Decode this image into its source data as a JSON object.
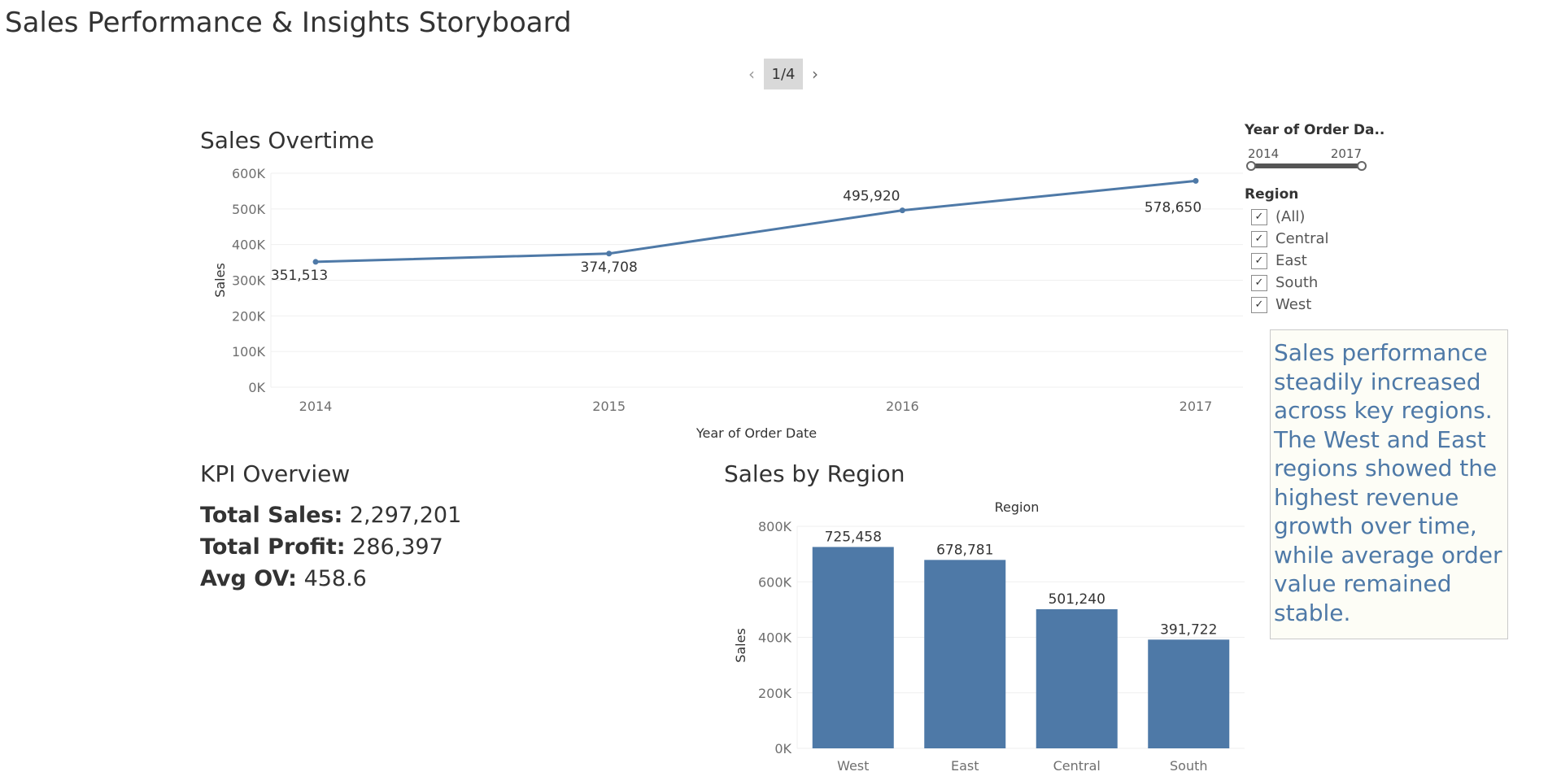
{
  "page": {
    "title": "Sales Performance & Insights Storyboard",
    "pager": {
      "current": "1/4",
      "prev_icon": "chevron-left-icon",
      "next_icon": "chevron-right-icon"
    }
  },
  "colors": {
    "series": "#4e79a7",
    "caption_text": "#4e79a7"
  },
  "line_chart": {
    "title": "Sales Overtime"
  },
  "kpi": {
    "title": "KPI Overview",
    "items": [
      {
        "label": "Total Sales:",
        "value": "2,297,201"
      },
      {
        "label": "Total Profit:",
        "value": "286,397"
      },
      {
        "label": "Avg OV:",
        "value": "458.6"
      }
    ]
  },
  "bar_chart": {
    "title": "Sales by Region"
  },
  "filters": {
    "year": {
      "title": "Year of Order Da..",
      "min_label": "2014",
      "max_label": "2017"
    },
    "region": {
      "title": "Region",
      "options": [
        "(All)",
        "Central",
        "East",
        "South",
        "West"
      ],
      "check_glyph": "✓"
    }
  },
  "caption": "Sales performance steadily increased across key regions. The West and East regions showed the highest revenue growth over time, while average order value remained stable.",
  "chart_data": [
    {
      "type": "line",
      "title": "Sales Overtime",
      "xlabel": "Year of Order Date",
      "ylabel": "Sales",
      "x": [
        "2014",
        "2015",
        "2016",
        "2017"
      ],
      "values": [
        351513,
        374708,
        495920,
        578650
      ],
      "labels": [
        "351,513",
        "374,708",
        "495,920",
        "578,650"
      ],
      "yticks": [
        0,
        100000,
        200000,
        300000,
        400000,
        500000,
        600000
      ],
      "ytick_labels": [
        "0K",
        "100K",
        "200K",
        "300K",
        "400K",
        "500K",
        "600K"
      ],
      "ylim": [
        0,
        600000
      ],
      "grid": true
    },
    {
      "type": "bar",
      "title": "Sales by Region",
      "header": "Region",
      "ylabel": "Sales",
      "categories": [
        "West",
        "East",
        "Central",
        "South"
      ],
      "values": [
        725458,
        678781,
        501240,
        391722
      ],
      "labels": [
        "725,458",
        "678,781",
        "501,240",
        "391,722"
      ],
      "yticks": [
        0,
        200000,
        400000,
        600000,
        800000
      ],
      "ytick_labels": [
        "0K",
        "200K",
        "400K",
        "600K",
        "800K"
      ],
      "ylim": [
        0,
        800000
      ],
      "grid": true
    }
  ]
}
